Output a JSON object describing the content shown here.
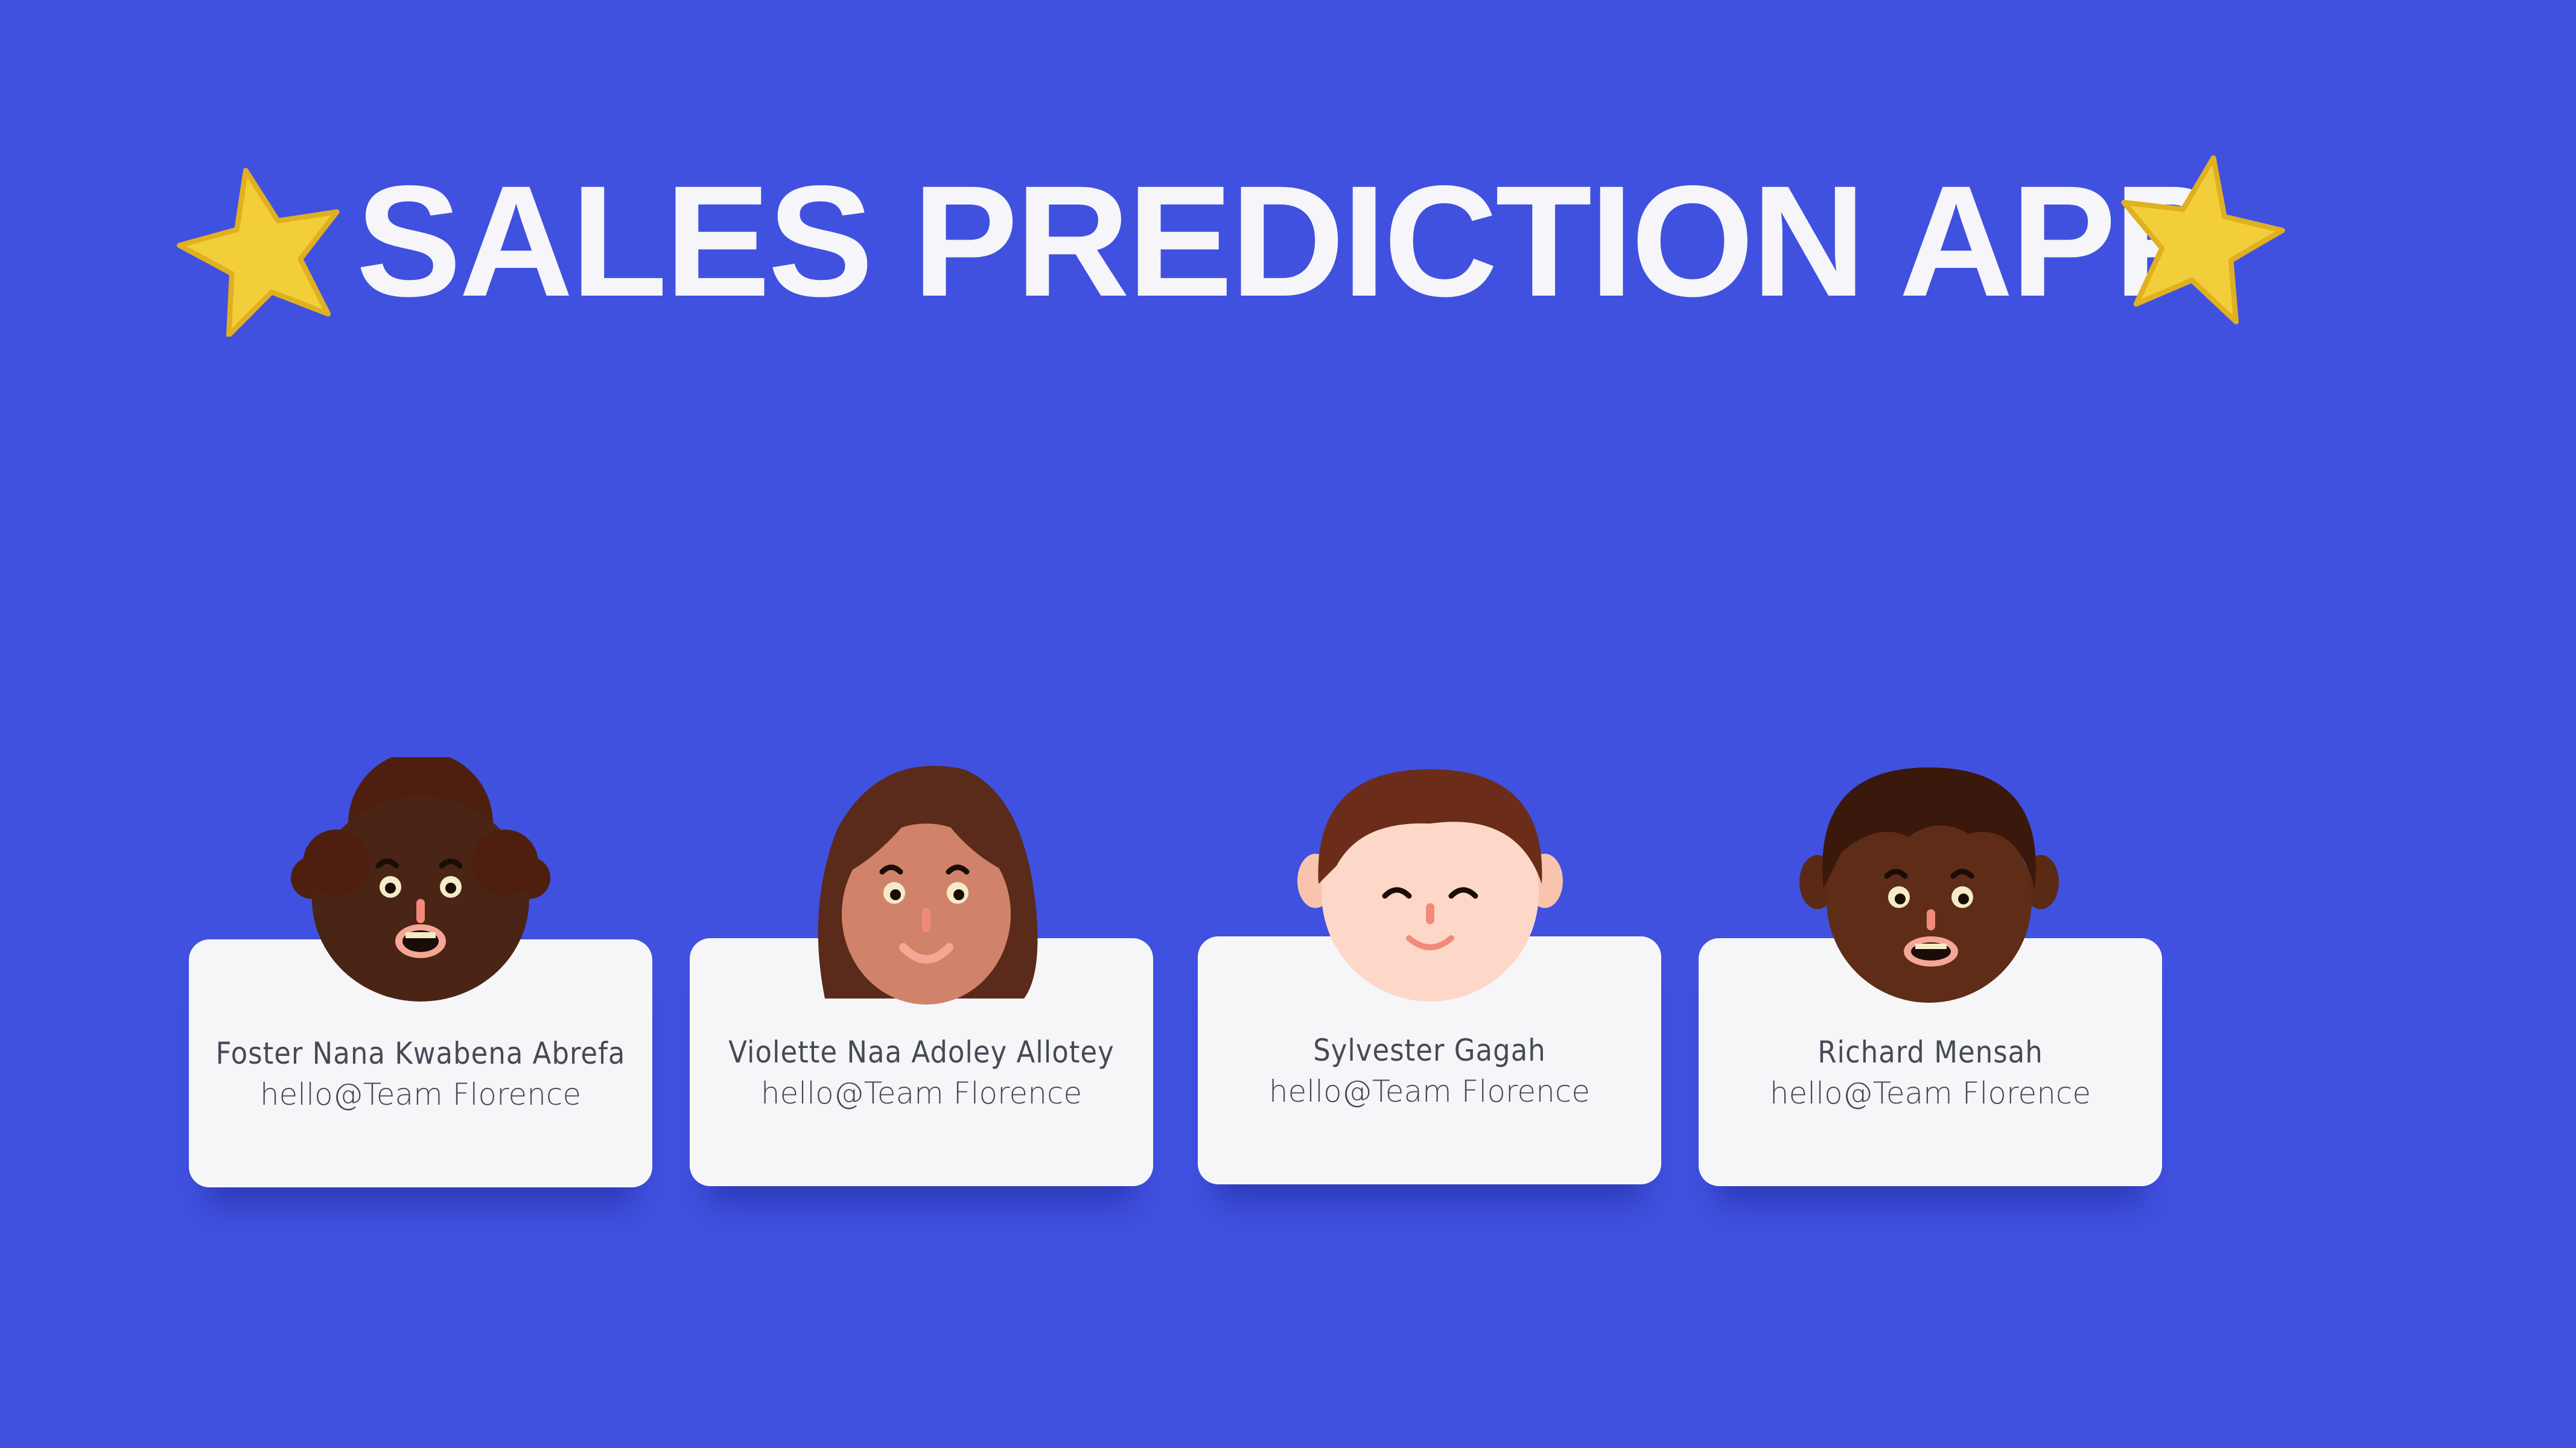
{
  "header": {
    "title": "SALES PREDICTION APP",
    "left_icon": "star-icon",
    "right_icon": "star-icon"
  },
  "colors": {
    "background": "#4051e0",
    "card": "#f6f6f9",
    "text": "#454a55",
    "star": "#f2cf3a"
  },
  "team": [
    {
      "name": "Foster Nana Kwabena Abrefa",
      "email": "hello@Team Florence",
      "avatar": "avatar-curly-hair-man"
    },
    {
      "name": "Violette Naa Adoley Allotey",
      "email": "hello@Team Florence",
      "avatar": "avatar-long-hair-woman"
    },
    {
      "name": "Sylvester Gagah",
      "email": "hello@Team Florence",
      "avatar": "avatar-smiling-man"
    },
    {
      "name": "Richard Mensah",
      "email": "hello@Team Florence",
      "avatar": "avatar-short-hair-man"
    }
  ]
}
